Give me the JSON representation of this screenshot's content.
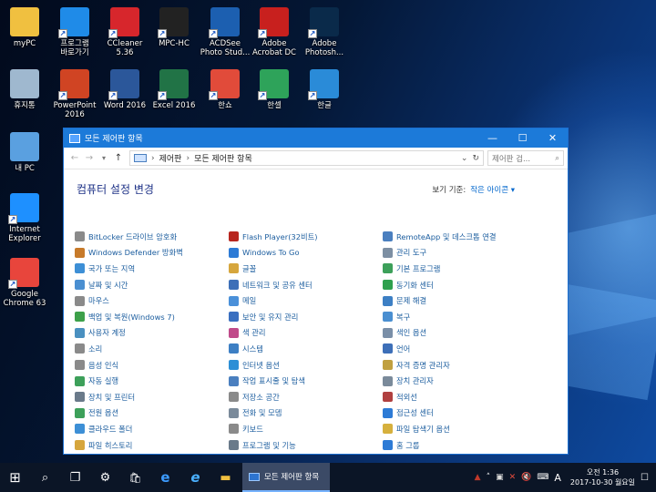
{
  "desktop": {
    "icons": [
      {
        "label": "myPC",
        "icon": "user-folder-icon",
        "color": "#f0c040"
      },
      {
        "label": "프로그램\n바로가기",
        "icon": "star-shortcut-icon",
        "color": "#1f8be8"
      },
      {
        "label": "CCleaner\n5.36",
        "icon": "ccleaner-icon",
        "color": "#d7262c"
      },
      {
        "label": "MPC-HC",
        "icon": "mpc-hc-icon",
        "color": "#222222"
      },
      {
        "label": "ACDSee\nPhoto Stud...",
        "icon": "acdsee-icon",
        "color": "#1c5fb0"
      },
      {
        "label": "Adobe\nAcrobat DC",
        "icon": "acrobat-icon",
        "color": "#c8201e"
      },
      {
        "label": "Adobe\nPhotosh...",
        "icon": "photoshop-icon",
        "color": "#0a2a4a"
      },
      {
        "label": "휴지통",
        "icon": "recycle-bin-icon",
        "color": "#9fb8cf"
      },
      {
        "label": "PowerPoint\n2016",
        "icon": "powerpoint-icon",
        "color": "#d04423"
      },
      {
        "label": "Word 2016",
        "icon": "word-icon",
        "color": "#2b579a"
      },
      {
        "label": "Excel 2016",
        "icon": "excel-icon",
        "color": "#217346"
      },
      {
        "label": "한쇼",
        "icon": "hanshow-icon",
        "color": "#e14b3a"
      },
      {
        "label": "한셀",
        "icon": "hancell-icon",
        "color": "#2ea35a"
      },
      {
        "label": "한글",
        "icon": "hangul-icon",
        "color": "#2a8bd8"
      },
      {
        "label": "내 PC",
        "icon": "this-pc-icon",
        "color": "#5aa0e0"
      },
      {
        "label": "Internet\nExplorer",
        "icon": "internet-explorer-icon",
        "color": "#1e90ff"
      },
      {
        "label": "Google\nChrome 63",
        "icon": "chrome-icon",
        "color": "#e8453c"
      }
    ]
  },
  "window": {
    "title": "모든 제어판 항목",
    "minimize": "—",
    "maximize": "☐",
    "close": "✕",
    "back": "←",
    "forward": "→",
    "up": "↑",
    "breadcrumb": [
      "제어판",
      "모든 제어판 항목"
    ],
    "search_placeholder": "제어판 검...",
    "heading": "컴퓨터 설정 변경",
    "view_by_label": "보기 기준:",
    "view_by_value": "작은 아이콘 ▾",
    "items": [
      {
        "label": "BitLocker 드라이브 암호화",
        "color": "#8a8a8a"
      },
      {
        "label": "Flash Player(32비트)",
        "color": "#b8261f"
      },
      {
        "label": "RemoteApp 및 데스크톱 연결",
        "color": "#4a7fbf"
      },
      {
        "label": "Windows Defender 방화벽",
        "color": "#c77a2a"
      },
      {
        "label": "Windows To Go",
        "color": "#2d7bd6"
      },
      {
        "label": "관리 도구",
        "color": "#7d8fa3"
      },
      {
        "label": "국가 또는 지역",
        "color": "#3d8fd6"
      },
      {
        "label": "글꼴",
        "color": "#d6a63d"
      },
      {
        "label": "기본 프로그램",
        "color": "#3da05a"
      },
      {
        "label": "날짜 및 시간",
        "color": "#4a8fd1"
      },
      {
        "label": "네트워크 및 공유 센터",
        "color": "#3d6fb8"
      },
      {
        "label": "동기화 센터",
        "color": "#2fa04e"
      },
      {
        "label": "마우스",
        "color": "#8a8a8a"
      },
      {
        "label": "메일",
        "color": "#4a90d9"
      },
      {
        "label": "문제 해결",
        "color": "#3d7fc4"
      },
      {
        "label": "백업 및 복원(Windows 7)",
        "color": "#3da04a"
      },
      {
        "label": "보안 및 유지 관리",
        "color": "#3a6fc0"
      },
      {
        "label": "복구",
        "color": "#4a8fd1"
      },
      {
        "label": "사용자 계정",
        "color": "#4a90c0"
      },
      {
        "label": "색 관리",
        "color": "#c04a8a"
      },
      {
        "label": "색인 옵션",
        "color": "#7a8fa8"
      },
      {
        "label": "소리",
        "color": "#8a8a8a"
      },
      {
        "label": "시스템",
        "color": "#3d7fc4"
      },
      {
        "label": "언어",
        "color": "#3d6fb8"
      },
      {
        "label": "음성 인식",
        "color": "#8a8a8a"
      },
      {
        "label": "인터넷 옵션",
        "color": "#2d8fd6"
      },
      {
        "label": "자격 증명 관리자",
        "color": "#c0a040"
      },
      {
        "label": "자동 실행",
        "color": "#3da05a"
      },
      {
        "label": "작업 표시줄 및 탐색",
        "color": "#4a7fbf"
      },
      {
        "label": "장치 관리자",
        "color": "#7a8a9a"
      },
      {
        "label": "장치 및 프린터",
        "color": "#6a7a8a"
      },
      {
        "label": "저장소 공간",
        "color": "#8a8a8a"
      },
      {
        "label": "적외선",
        "color": "#b04040"
      },
      {
        "label": "전원 옵션",
        "color": "#3da05a"
      },
      {
        "label": "전화 및 모뎀",
        "color": "#7a8a9a"
      },
      {
        "label": "접근성 센터",
        "color": "#2d7bd6"
      },
      {
        "label": "클라우드 폴더",
        "color": "#3d8fd6"
      },
      {
        "label": "키보드",
        "color": "#8a8a8a"
      },
      {
        "label": "파일 탐색기 옵션",
        "color": "#d6b03d"
      },
      {
        "label": "파일 히스토리",
        "color": "#d6a63d"
      },
      {
        "label": "프로그램 및 기능",
        "color": "#6a7a8a"
      },
      {
        "label": "홈 그룹",
        "color": "#2d7bd6"
      }
    ]
  },
  "taskbar": {
    "start": "⊞",
    "search": "⌕",
    "task_view": "❐",
    "settings": "⚙",
    "store": "🛍",
    "edge": "e",
    "ie": "e",
    "explorer": "▬",
    "active_window": "모든 제어판 항목",
    "ime": "A",
    "time": "오전 1:36",
    "date": "2017-10-30 월요일",
    "notifications": "☐"
  },
  "colors": {
    "accent": "#1c7ad9",
    "link": "#1a5c9e",
    "heading": "#1e3287",
    "taskbar": "#0b1526"
  }
}
